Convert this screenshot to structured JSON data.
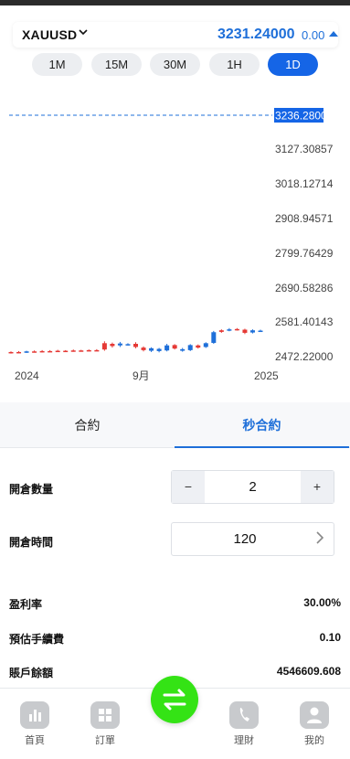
{
  "header": {
    "symbol": "XAUUSD",
    "price": "3231.24000",
    "change": "0.00",
    "accent": "#1e6fd9"
  },
  "timeframes": [
    {
      "label": "1M",
      "active": false
    },
    {
      "label": "15M",
      "active": false
    },
    {
      "label": "30M",
      "active": false
    },
    {
      "label": "1H",
      "active": false
    },
    {
      "label": "1D",
      "active": true
    }
  ],
  "chart": {
    "current_price_label": "3236.28000",
    "y_tick_labels": [
      "3127.30857",
      "3018.12714",
      "2908.94571",
      "2799.76429",
      "2690.58286",
      "2581.40143",
      "2472.22000"
    ],
    "x_tick_labels": [
      "2024",
      "9月",
      "2025"
    ]
  },
  "chart_data": {
    "type": "candlestick",
    "symbol": "XAUUSD",
    "ylim": [
      2472.22,
      3236.28
    ],
    "y_ticks": [
      3127.30857,
      3018.12714,
      2908.94571,
      2799.76429,
      2690.58286,
      2581.40143,
      2472.22
    ],
    "x_ticks": [
      "2024",
      "9月",
      "2025"
    ],
    "current_price": 3236.28,
    "candles": [
      {
        "open": 2481,
        "close": 2484,
        "high": 2486,
        "low": 2479,
        "color": "red"
      },
      {
        "open": 2484,
        "close": 2483,
        "high": 2487,
        "low": 2480,
        "color": "red"
      },
      {
        "open": 2483,
        "close": 2486,
        "high": 2488,
        "low": 2481,
        "color": "blue"
      },
      {
        "open": 2486,
        "close": 2485,
        "high": 2489,
        "low": 2483,
        "color": "red"
      },
      {
        "open": 2485,
        "close": 2487,
        "high": 2490,
        "low": 2483,
        "color": "red"
      },
      {
        "open": 2487,
        "close": 2486,
        "high": 2490,
        "low": 2484,
        "color": "red"
      },
      {
        "open": 2486,
        "close": 2488,
        "high": 2491,
        "low": 2484,
        "color": "red"
      },
      {
        "open": 2488,
        "close": 2487,
        "high": 2490,
        "low": 2485,
        "color": "red"
      },
      {
        "open": 2487,
        "close": 2489,
        "high": 2492,
        "low": 2485,
        "color": "red"
      },
      {
        "open": 2489,
        "close": 2488,
        "high": 2491,
        "low": 2486,
        "color": "red"
      },
      {
        "open": 2488,
        "close": 2490,
        "high": 2492,
        "low": 2486,
        "color": "red"
      },
      {
        "open": 2490,
        "close": 2489,
        "high": 2493,
        "low": 2487,
        "color": "red"
      },
      {
        "open": 2492,
        "close": 2512,
        "high": 2518,
        "low": 2488,
        "color": "red"
      },
      {
        "open": 2510,
        "close": 2503,
        "high": 2514,
        "low": 2498,
        "color": "red"
      },
      {
        "open": 2505,
        "close": 2511,
        "high": 2516,
        "low": 2500,
        "color": "blue"
      },
      {
        "open": 2509,
        "close": 2508,
        "high": 2512,
        "low": 2505,
        "color": "blue"
      },
      {
        "open": 2510,
        "close": 2500,
        "high": 2515,
        "low": 2496,
        "color": "red"
      },
      {
        "open": 2498,
        "close": 2490,
        "high": 2502,
        "low": 2486,
        "color": "red"
      },
      {
        "open": 2488,
        "close": 2496,
        "high": 2499,
        "low": 2484,
        "color": "blue"
      },
      {
        "open": 2494,
        "close": 2487,
        "high": 2497,
        "low": 2483,
        "color": "blue"
      },
      {
        "open": 2489,
        "close": 2505,
        "high": 2510,
        "low": 2486,
        "color": "blue"
      },
      {
        "open": 2506,
        "close": 2495,
        "high": 2509,
        "low": 2492,
        "color": "red"
      },
      {
        "open": 2493,
        "close": 2488,
        "high": 2497,
        "low": 2485,
        "color": "blue"
      },
      {
        "open": 2490,
        "close": 2506,
        "high": 2509,
        "low": 2487,
        "color": "blue"
      },
      {
        "open": 2505,
        "close": 2498,
        "high": 2508,
        "low": 2495,
        "color": "red"
      },
      {
        "open": 2500,
        "close": 2512,
        "high": 2515,
        "low": 2497,
        "color": "blue"
      },
      {
        "open": 2513,
        "close": 2547,
        "high": 2551,
        "low": 2510,
        "color": "blue"
      },
      {
        "open": 2548,
        "close": 2553,
        "high": 2556,
        "low": 2545,
        "color": "red"
      },
      {
        "open": 2553,
        "close": 2556,
        "high": 2560,
        "low": 2550,
        "color": "blue"
      },
      {
        "open": 2557,
        "close": 2554,
        "high": 2560,
        "low": 2552,
        "color": "red"
      },
      {
        "open": 2555,
        "close": 2545,
        "high": 2558,
        "low": 2541,
        "color": "red"
      },
      {
        "open": 2546,
        "close": 2553,
        "high": 2556,
        "low": 2543,
        "color": "blue"
      },
      {
        "open": 2552,
        "close": 2551,
        "high": 2555,
        "low": 2549,
        "color": "blue"
      }
    ]
  },
  "tabs": [
    {
      "label": "合約",
      "active": false
    },
    {
      "label": "秒合約",
      "active": true
    }
  ],
  "form": {
    "quantity_label": "開倉數量",
    "quantity_value": "2",
    "minus": "−",
    "plus": "+",
    "time_label": "開倉時間",
    "time_value": "120"
  },
  "info": {
    "profit_rate_label": "盈利率",
    "profit_rate_value": "30.00%",
    "fee_label": "預估手續費",
    "fee_value": "0.10",
    "balance_label": "賬戶餘額",
    "balance_value": "4546609.608"
  },
  "nav": [
    {
      "label": "首頁",
      "icon": "bar-chart-icon"
    },
    {
      "label": "訂單",
      "icon": "grid-icon"
    },
    {
      "label": "理財",
      "icon": "phone-icon"
    },
    {
      "label": "我的",
      "icon": "user-icon"
    }
  ],
  "fab_icon": "swap-arrows-icon"
}
